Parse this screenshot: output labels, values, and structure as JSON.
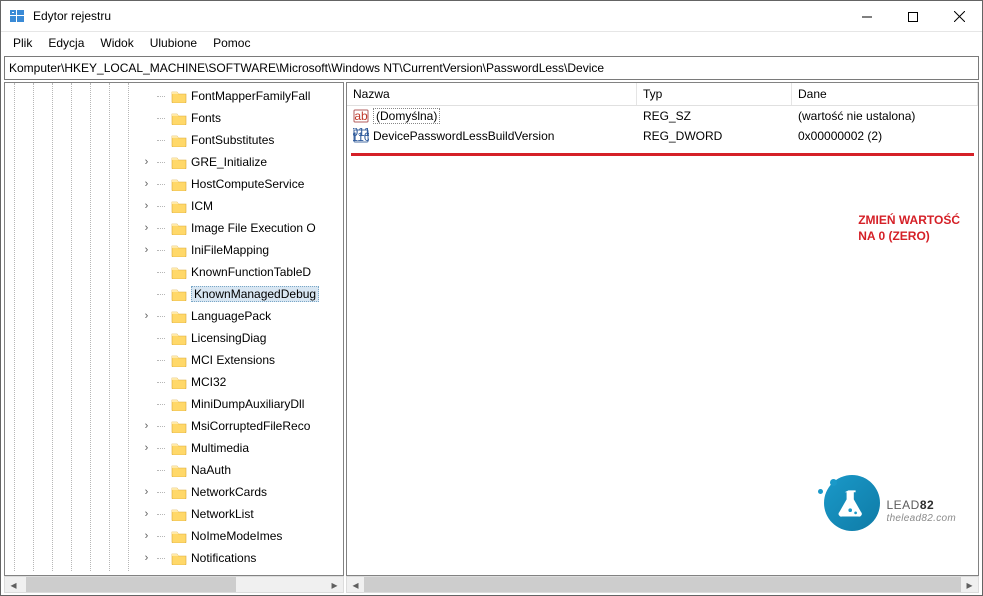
{
  "window": {
    "title": "Edytor rejestru"
  },
  "menu": {
    "items": [
      "Plik",
      "Edycja",
      "Widok",
      "Ulubione",
      "Pomoc"
    ]
  },
  "address": "Komputer\\HKEY_LOCAL_MACHINE\\SOFTWARE\\Microsoft\\Windows NT\\CurrentVersion\\PasswordLess\\Device",
  "tree": {
    "items": [
      {
        "label": "FontMapperFamilyFall",
        "expandable": false
      },
      {
        "label": "Fonts",
        "expandable": false
      },
      {
        "label": "FontSubstitutes",
        "expandable": false
      },
      {
        "label": "GRE_Initialize",
        "expandable": true
      },
      {
        "label": "HostComputeService",
        "expandable": true
      },
      {
        "label": "ICM",
        "expandable": true
      },
      {
        "label": "Image File Execution O",
        "expandable": true
      },
      {
        "label": "IniFileMapping",
        "expandable": true
      },
      {
        "label": "KnownFunctionTableD",
        "expandable": false
      },
      {
        "label": "KnownManagedDebug",
        "expandable": false,
        "selected": true
      },
      {
        "label": "LanguagePack",
        "expandable": true
      },
      {
        "label": "LicensingDiag",
        "expandable": false
      },
      {
        "label": "MCI Extensions",
        "expandable": false
      },
      {
        "label": "MCI32",
        "expandable": false
      },
      {
        "label": "MiniDumpAuxiliaryDll",
        "expandable": false
      },
      {
        "label": "MsiCorruptedFileReco",
        "expandable": true
      },
      {
        "label": "Multimedia",
        "expandable": true
      },
      {
        "label": "NaAuth",
        "expandable": false
      },
      {
        "label": "NetworkCards",
        "expandable": true
      },
      {
        "label": "NetworkList",
        "expandable": true
      },
      {
        "label": "NoImeModeImes",
        "expandable": true
      },
      {
        "label": "Notifications",
        "expandable": true
      }
    ]
  },
  "list": {
    "columns": {
      "name": "Nazwa",
      "type": "Typ",
      "data": "Dane"
    },
    "rows": [
      {
        "icon": "string",
        "name": "(Domyślna)",
        "type": "REG_SZ",
        "data": "(wartość nie ustalona)",
        "selected": true
      },
      {
        "icon": "binary",
        "name": "DevicePasswordLessBuildVersion",
        "type": "REG_DWORD",
        "data": "0x00000002 (2)"
      }
    ]
  },
  "annotation": {
    "line1": "ZMIEŃ WARTOŚĆ",
    "line2": "NA 0 (ZERO)"
  },
  "logo": {
    "brand_light": "LEAD",
    "brand_bold": "82",
    "url": "thelead82.com"
  }
}
